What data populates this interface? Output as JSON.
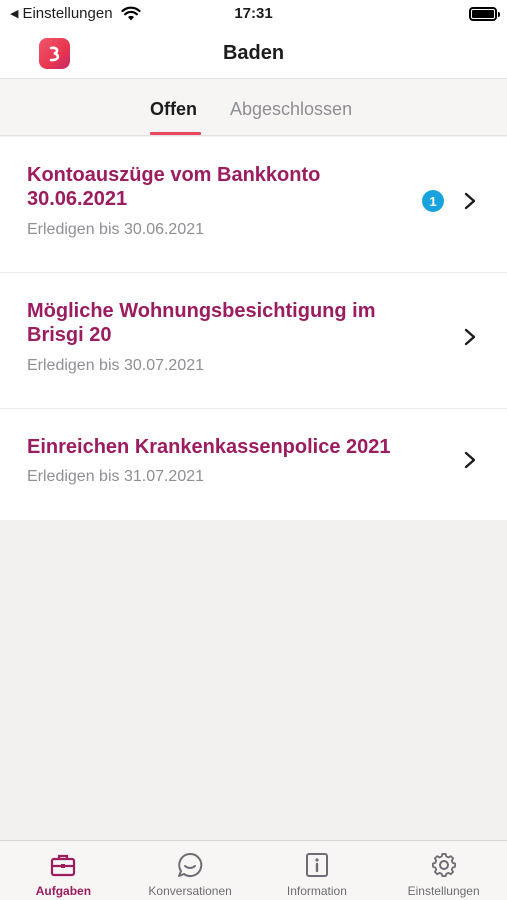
{
  "status_bar": {
    "back_label": "Einstellungen",
    "time": "17:31"
  },
  "nav": {
    "title": "Baden"
  },
  "tabs": [
    {
      "label": "Offen",
      "active": true
    },
    {
      "label": "Abgeschlossen",
      "active": false
    }
  ],
  "tasks": [
    {
      "title": "Kontoauszüge vom Bankkonto 30.06.2021",
      "due": "Erledigen bis 30.06.2021",
      "badge": "1"
    },
    {
      "title": "Mögliche Wohnungsbesichtigung im Brisgi 20",
      "due": "Erledigen bis 30.07.2021",
      "badge": null
    },
    {
      "title": "Einreichen Krankenkassenpolice 2021",
      "due": "Erledigen bis 31.07.2021",
      "badge": null
    }
  ],
  "tab_bar": [
    {
      "label": "Aufgaben",
      "icon": "briefcase-icon",
      "active": true
    },
    {
      "label": "Konversationen",
      "icon": "chat-bubble-icon",
      "active": false
    },
    {
      "label": "Information",
      "icon": "info-document-icon",
      "active": false
    },
    {
      "label": "Einstellungen",
      "icon": "gear-icon",
      "active": false
    }
  ],
  "colors": {
    "accent": "#9b1c5f",
    "tab_indicator": "#e8475f",
    "badge": "#19a3de",
    "background": "#f2f1ef"
  }
}
